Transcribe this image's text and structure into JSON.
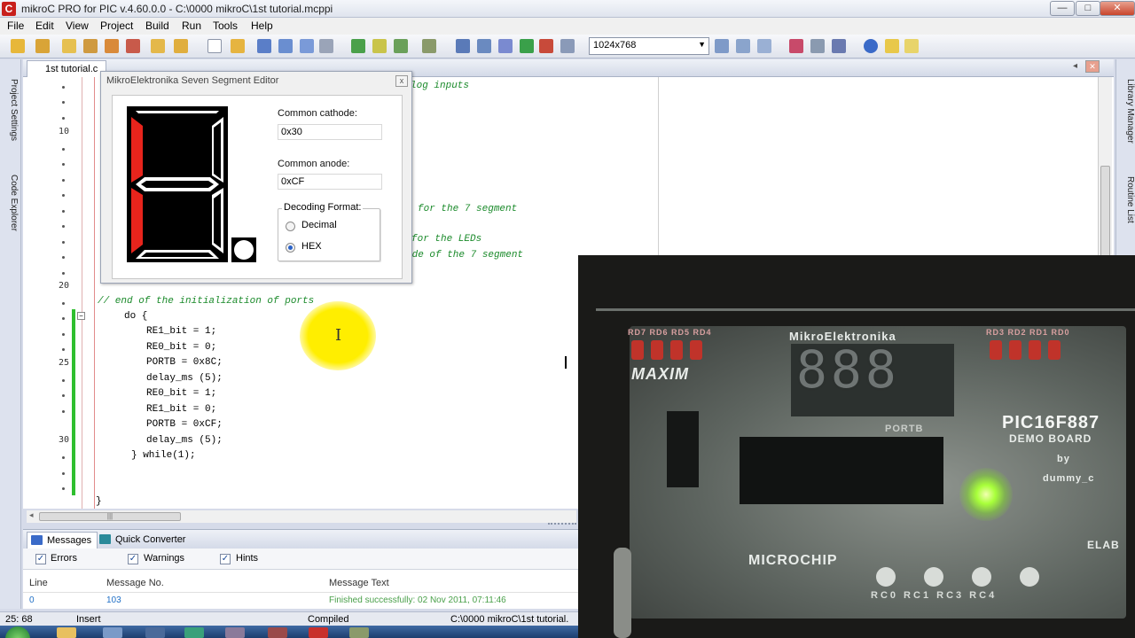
{
  "window": {
    "app_icon": "C",
    "title": "mikroC PRO for PIC v.4.60.0.0 - C:\\0000 mikroC\\1st tutorial.mcppi",
    "min": "—",
    "max": "□",
    "close": "✕"
  },
  "menu": [
    "File",
    "Edit",
    "View",
    "Project",
    "Build",
    "Run",
    "Tools",
    "Help"
  ],
  "toolbar": {
    "resolution": "1024x768"
  },
  "side_tabs": {
    "left": [
      "Project Settings",
      "Code Explorer"
    ],
    "right": [
      "Library Manager",
      "Routine List"
    ]
  },
  "editor": {
    "file_tab": "1st tutorial.c",
    "line_numbers": [
      "10",
      "20",
      "25",
      "30"
    ],
    "code": {
      "c_analog": "log inputs",
      "c_seg1": "for the 7 segment",
      "c_leds": "for the LEDs",
      "c_seg2": "ode of the 7 segment",
      "c_end": "// end of the initialization of ports",
      "do": "do {",
      "l1": "RE1_bit = 1;",
      "l2": "RE0_bit = 0;",
      "l3": "PORTB = 0x8C;",
      "l4": "delay_ms (5);",
      "l5": "RE0_bit = 1;",
      "l6": "RE1_bit = 0;",
      "l7": "PORTB = 0xCF;",
      "l8": "delay_ms (5);",
      "l9": "} while(1);",
      "l10": "}"
    }
  },
  "seg_editor": {
    "title": "MikroElektronika Seven Segment Editor",
    "close": "x",
    "cathode_label": "Common cathode:",
    "cathode_value": "0x30",
    "anode_label": "Common anode:",
    "anode_value": "0xCF",
    "decoding_label": "Decoding Format:",
    "options": [
      "Decimal",
      "HEX"
    ],
    "selected": "HEX",
    "active_segment_color": "#e8241c"
  },
  "messages": {
    "tabs": [
      "Messages",
      "Quick Converter"
    ],
    "filters": [
      "Errors",
      "Warnings",
      "Hints"
    ],
    "columns": [
      "Line",
      "Message No.",
      "Message Text"
    ],
    "rows": [
      {
        "line": "0",
        "no": "103",
        "text": "Finished successfully: 02 Nov 2011, 07:11:46"
      }
    ]
  },
  "status": {
    "position": "25: 68",
    "mode": "Insert",
    "state": "Compiled",
    "path": "C:\\0000 mikroC\\1st tutorial."
  },
  "video": {
    "brand": "MikroElektronika",
    "maxim": "MAXIM",
    "board_model": "PIC16F887",
    "board_sub": "DEMO BOARD",
    "by": "by",
    "author": "dummy_c",
    "portb": "PORTB",
    "microchip": "MICROCHIP",
    "elab": "ELAB",
    "digits": "888",
    "top_leds": "RD7 RD6 RD5 RD4",
    "top_leds_right": "RD3 RD2 RD1 RD0",
    "bottom_buttons": "RC0  RC1  RC3  RC4"
  }
}
